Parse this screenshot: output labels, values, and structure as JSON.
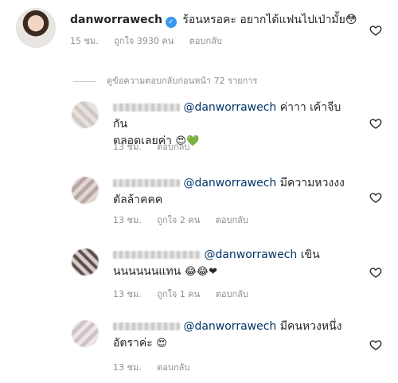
{
  "main_comment": {
    "username": "danworrawech",
    "text": "ร้อนหรอคะ อยากได้แฟนไปเป่ามั้ย😳",
    "time": "15 ชม.",
    "likes": "ถูกใจ 3930 คน",
    "reply": "ตอบกลับ"
  },
  "view_replies": "ดูข้อความตอบกลับก่อนหน้า 72 รายการ",
  "replies": [
    {
      "mention": "@danworrawech",
      "text_line1": "ค่าาา เค้าจีบกัน",
      "text_line2": "ตลอดเลยค่า",
      "emojis": "😍💚",
      "time": "13 ชม.",
      "likes": "",
      "reply": "ตอบกลับ"
    },
    {
      "mention": "@danworrawech",
      "text_line1": "มีความหวงงง",
      "text_line2": "ตัลล้าคคค",
      "emojis": "",
      "time": "13 ชม.",
      "likes": "ถูกใจ 2 คน",
      "reply": "ตอบกลับ"
    },
    {
      "mention": "@danworrawech",
      "text_line1": "เขิน",
      "text_line2": "นนนนนนแทน",
      "emojis": "😂😂❤",
      "time": "13 ชม.",
      "likes": "ถูกใจ 1 คน",
      "reply": "ตอบกลับ"
    },
    {
      "mention": "@danworrawech",
      "text_line1": "มีคนหวงหนึ่ง",
      "text_line2": "อัตราค่ะ",
      "emojis": "😍",
      "time": "13 ชม.",
      "likes": "",
      "reply": "ตอบกลับ"
    }
  ],
  "icons": {
    "like": "heart-icon",
    "verified": "verified-badge-icon"
  },
  "colors": {
    "mention": "#003569",
    "verified": "#3897f0",
    "meta": "#8e8e8e"
  }
}
